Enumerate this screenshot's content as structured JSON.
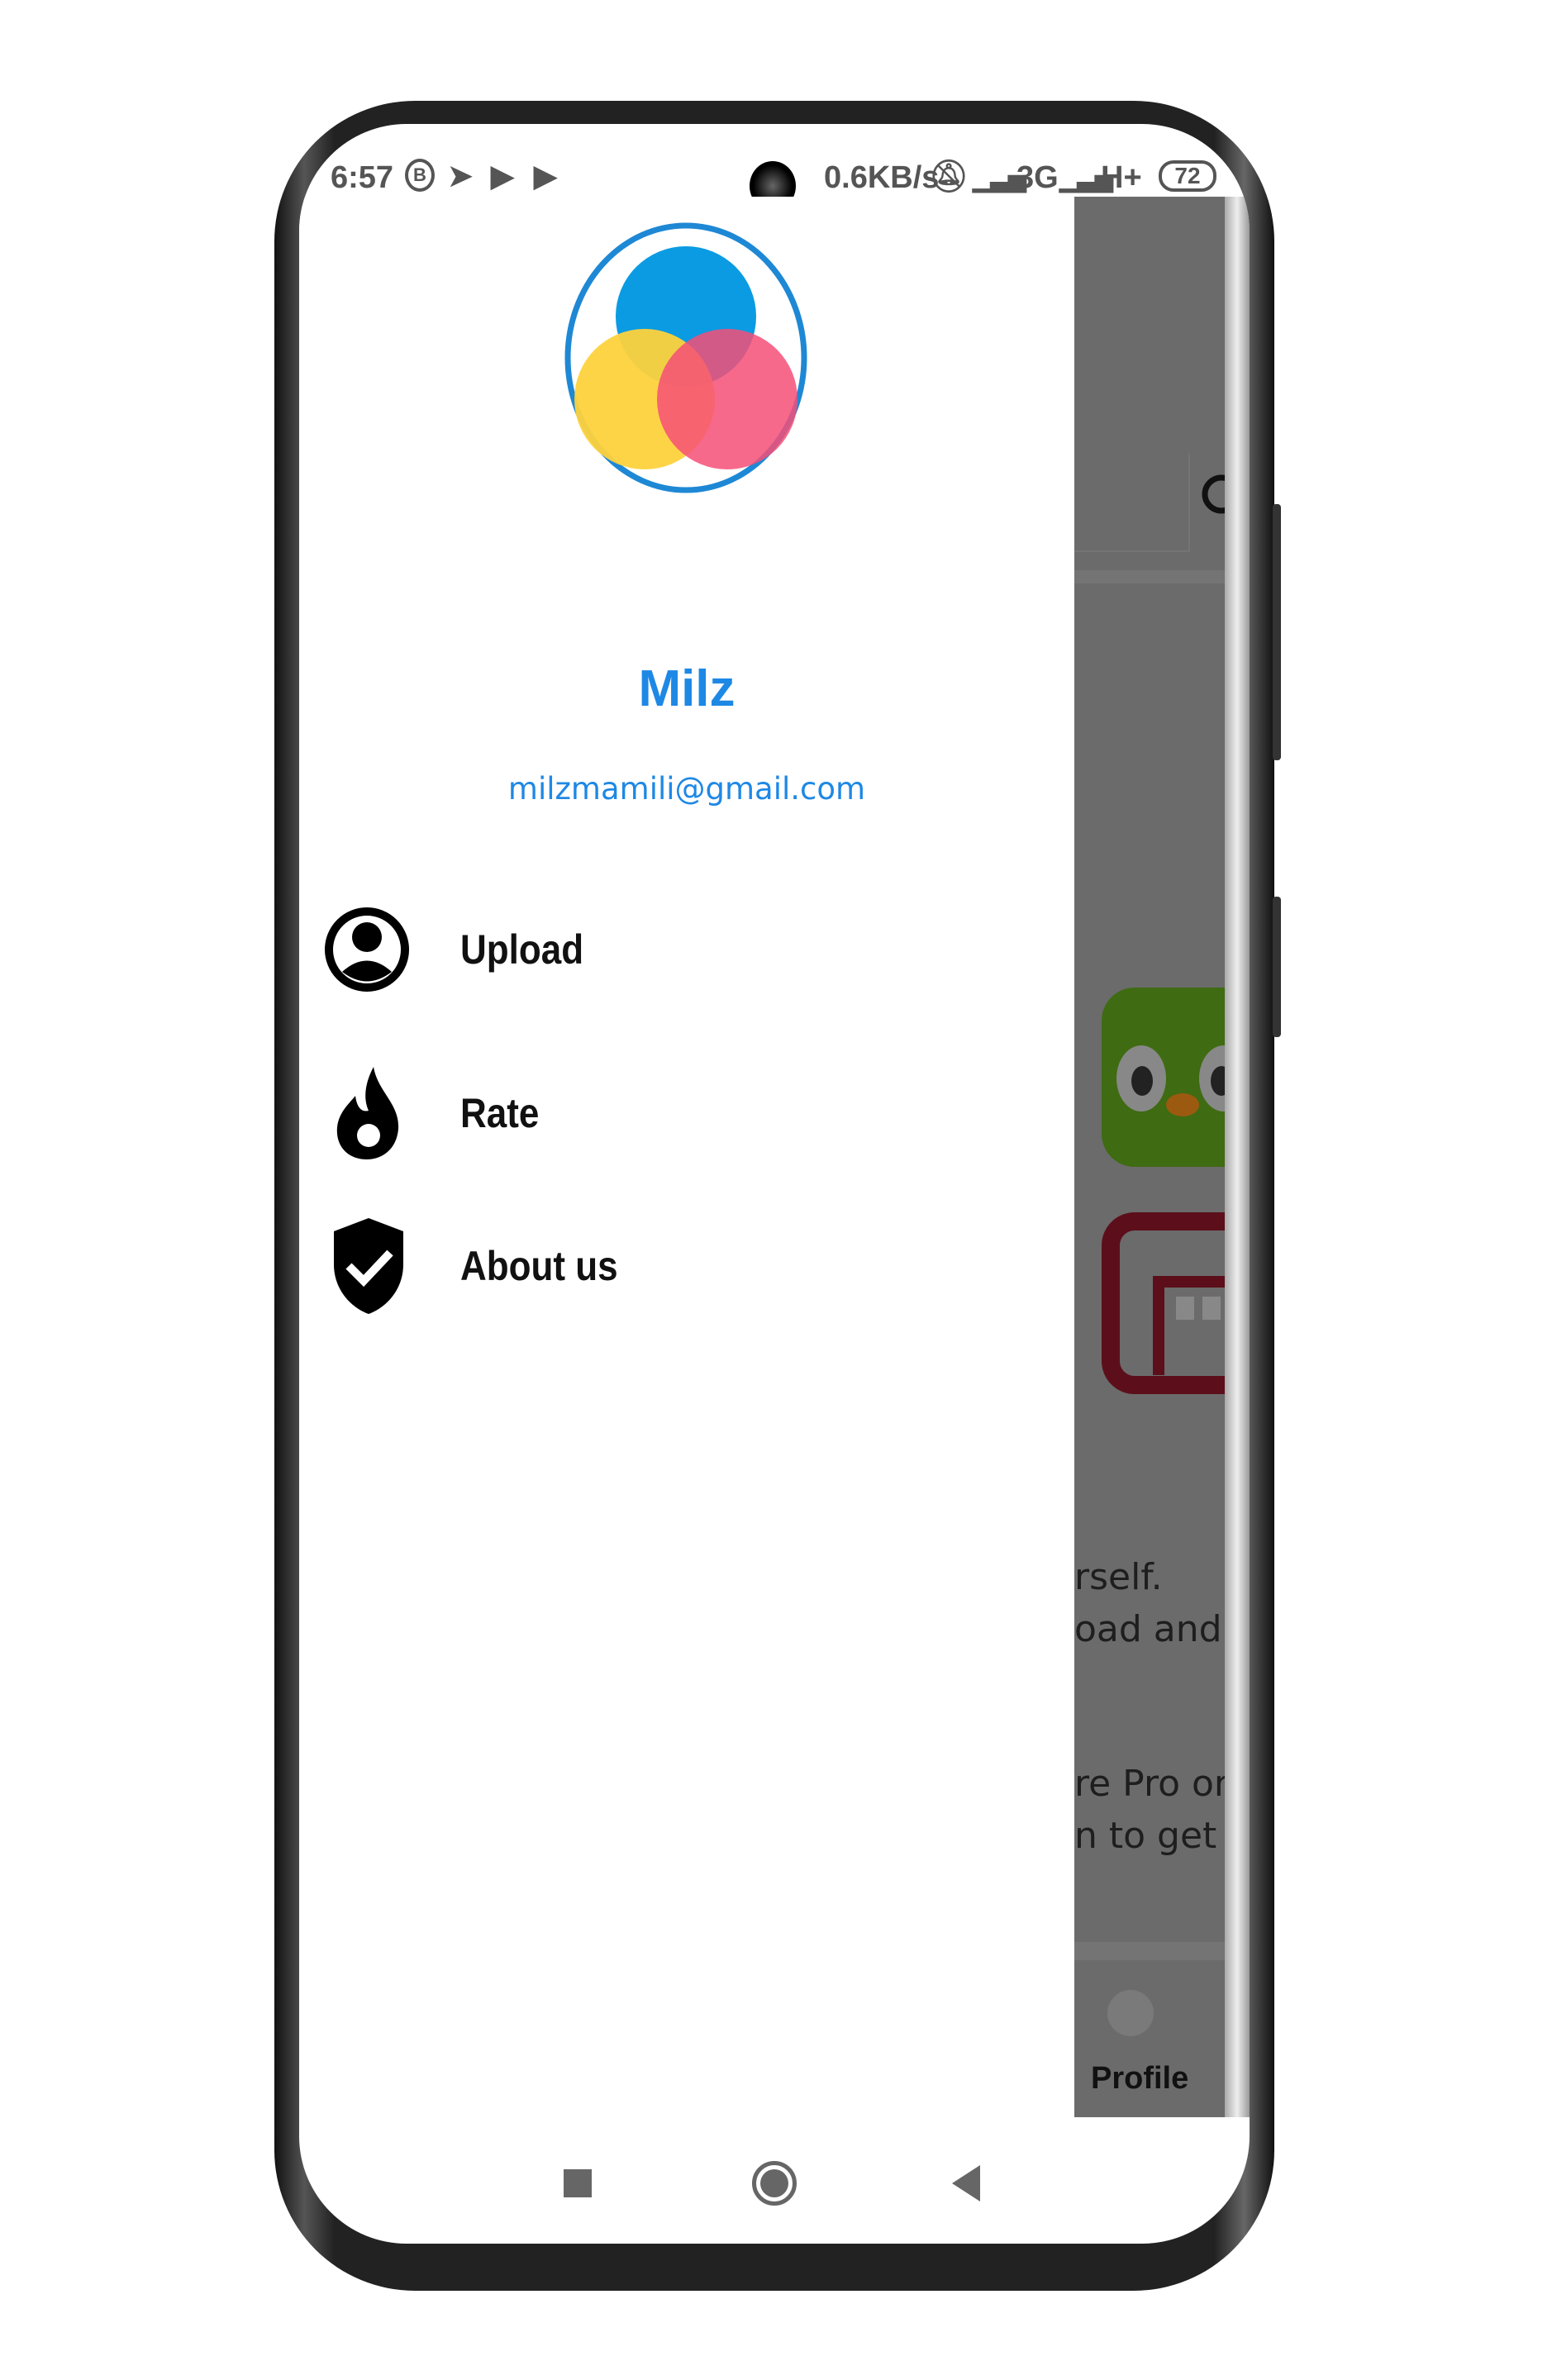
{
  "status_bar": {
    "time": "6:57",
    "network_speed": "0.6KB/s",
    "network1": "3G",
    "network2": "H+",
    "battery": "72",
    "icons": [
      "b-icon",
      "telegram-icon",
      "play-icon",
      "play-icon",
      "camera-icon",
      "bell-off-icon",
      "signal-icon",
      "signal-icon",
      "battery-icon"
    ]
  },
  "drawer": {
    "user_name": "Milz",
    "user_email": "milzmamili@gmail.com",
    "accent_color": "#1E88E5",
    "items": [
      {
        "label": "Upload",
        "icon": "account-circle-icon"
      },
      {
        "label": "Rate",
        "icon": "fire-icon"
      },
      {
        "label": "About us",
        "icon": "shield-check-icon"
      }
    ]
  },
  "background": {
    "text_lines": [
      "rself.",
      "oad and",
      "re Pro or",
      "n to get"
    ],
    "bottom_nav_label": "Profile"
  },
  "nav_bar": {
    "icons": [
      "recents-icon",
      "home-icon",
      "back-icon"
    ]
  }
}
